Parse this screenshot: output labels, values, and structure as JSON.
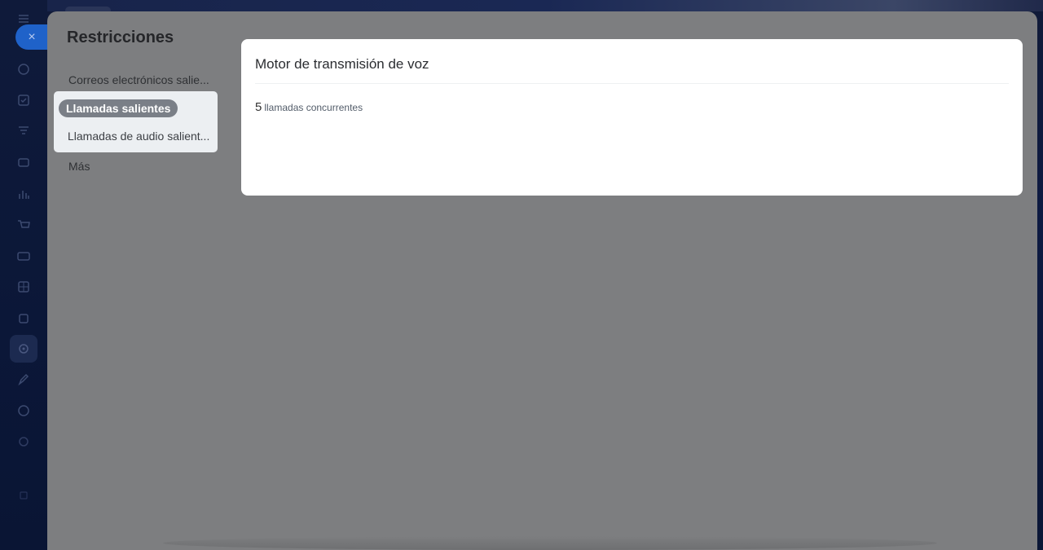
{
  "panel": {
    "title": "Restricciones"
  },
  "nav": {
    "items": [
      {
        "label": "Correos electrónicos salie..."
      },
      {
        "label": "Llamadas salientes",
        "active": true
      },
      {
        "label": "Llamadas de audio salient..."
      },
      {
        "label": "Más"
      }
    ]
  },
  "card": {
    "title": "Motor de transmisión de voz",
    "value": "5",
    "unit": "llamadas concurrentes"
  },
  "close": {
    "icon": "close-icon",
    "glyph": "×"
  },
  "colors": {
    "accent": "#1f62c9",
    "active_pill": "#7a7f87",
    "overlay": "#7d7e80"
  }
}
